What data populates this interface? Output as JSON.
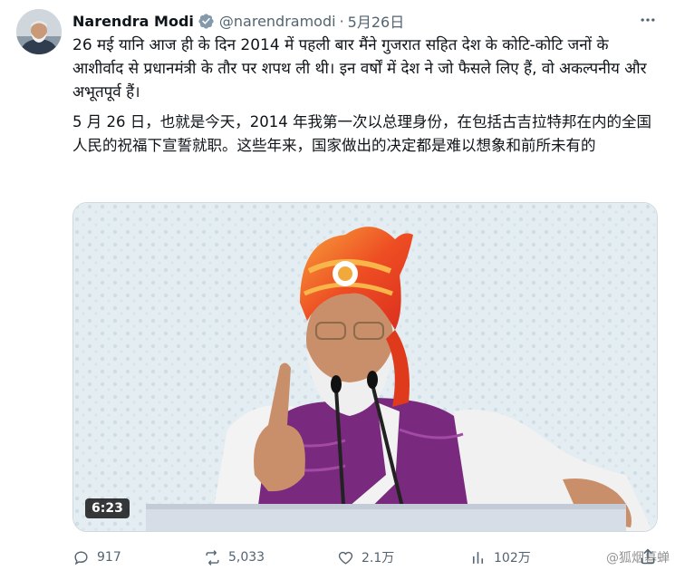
{
  "tweet": {
    "author_name": "Narendra Modi",
    "handle": "@narendramodi",
    "separator": "·",
    "date": "5月26日",
    "text_hindi": "26 मई यानि आज ही के दिन 2014 में पहली बार मैंने गुजरात सहित देश के कोटि-कोटि जनों के आशीर्वाद से प्रधानमंत्री के तौर पर शपथ ली थी। इन वर्षों में देश ने जो फैसले लिए हैं, वो अकल्पनीय और अभूतपूर्व हैं।",
    "text_translation": "5 月 26 日，也就是今天，2014 年我第一次以总理身份，在包括古吉拉特邦在内的全国人民的祝福下宣誓就职。这些年来，国家做出的决定都是难以想象和前所未有的"
  },
  "media": {
    "duration": "6:23"
  },
  "actions": {
    "replies": "917",
    "reposts": "5,033",
    "likes": "2.1万",
    "views": "102万"
  },
  "watermark": "@狐烟暮蝉",
  "icons": [
    "verified-badge-icon",
    "more-icon",
    "reply-icon",
    "repost-icon",
    "like-icon",
    "views-icon",
    "share-icon"
  ],
  "colors": {
    "text": "#0f1419",
    "secondary": "#536471",
    "verified_gray": "#829aab",
    "turban_orange": "#f05a22",
    "vest_purple": "#7a2a7e"
  }
}
